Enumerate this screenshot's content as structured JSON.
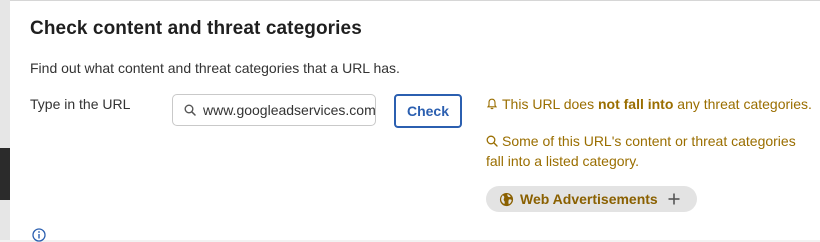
{
  "section": {
    "title": "Check content and threat categories",
    "description": "Find out what content and threat categories that a URL has."
  },
  "url_form": {
    "label": "Type in the URL",
    "input_value": "www.googleadservices.com",
    "button_label": "Check"
  },
  "results": {
    "threat_prefix": "This URL does ",
    "threat_bold": "not fall into",
    "threat_suffix": " any threat categories.",
    "content_text": "Some of this URL's content or threat categories fall into a listed category.",
    "category_chip": "Web Advertisements"
  },
  "colors": {
    "accent_blue": "#2b5fb0",
    "result_gold": "#9a6e00"
  },
  "icons": {
    "search": "search-icon",
    "bell": "bell-icon",
    "search_result": "search-icon",
    "globe": "globe-icon",
    "plus": "plus-icon",
    "info": "info-icon"
  }
}
